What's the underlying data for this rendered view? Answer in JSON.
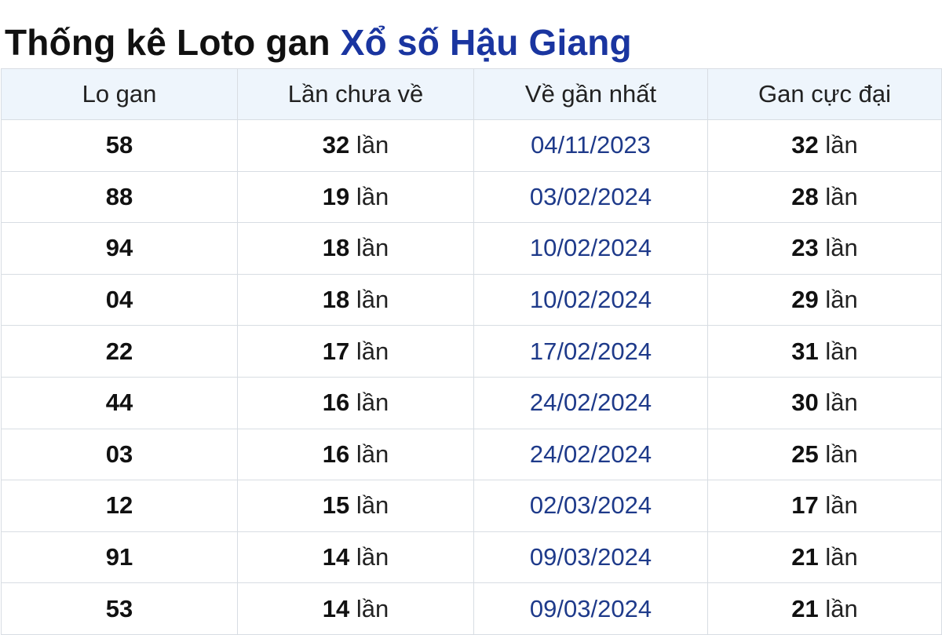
{
  "title": {
    "prefix": "Thống kê Loto gan",
    "highlight": "Xổ số Hậu Giang"
  },
  "colors": {
    "accent": "#1a35a0",
    "date_text": "#1e3a8a",
    "header_bg": "#eef5fc",
    "border": "#d8dde3"
  },
  "table": {
    "headers": [
      "Lo gan",
      "Lần chưa về",
      "Về gần nhất",
      "Gan cực đại"
    ],
    "unit": "lần",
    "rows": [
      {
        "lo": "58",
        "absent": "32",
        "last": "04/11/2023",
        "max": "32"
      },
      {
        "lo": "88",
        "absent": "19",
        "last": "03/02/2024",
        "max": "28"
      },
      {
        "lo": "94",
        "absent": "18",
        "last": "10/02/2024",
        "max": "23"
      },
      {
        "lo": "04",
        "absent": "18",
        "last": "10/02/2024",
        "max": "29"
      },
      {
        "lo": "22",
        "absent": "17",
        "last": "17/02/2024",
        "max": "31"
      },
      {
        "lo": "44",
        "absent": "16",
        "last": "24/02/2024",
        "max": "30"
      },
      {
        "lo": "03",
        "absent": "16",
        "last": "24/02/2024",
        "max": "25"
      },
      {
        "lo": "12",
        "absent": "15",
        "last": "02/03/2024",
        "max": "17"
      },
      {
        "lo": "91",
        "absent": "14",
        "last": "09/03/2024",
        "max": "21"
      },
      {
        "lo": "53",
        "absent": "14",
        "last": "09/03/2024",
        "max": "21"
      }
    ]
  }
}
